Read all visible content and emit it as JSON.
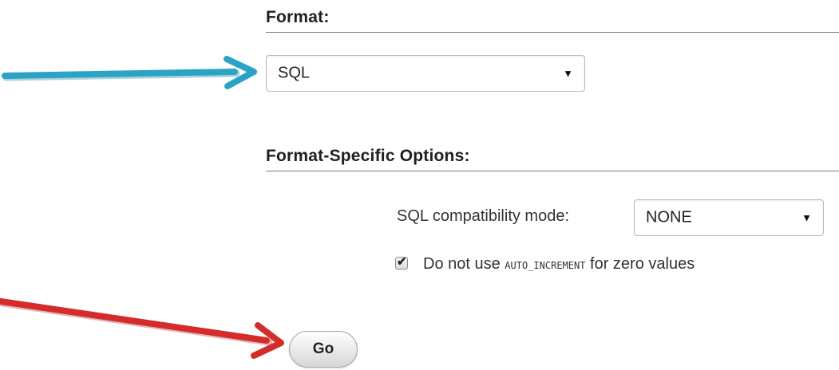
{
  "format_section": {
    "heading": "Format:",
    "select": {
      "value": "SQL",
      "caret_icon": "triangle-down"
    }
  },
  "options_section": {
    "heading": "Format-Specific Options:",
    "compatibility": {
      "label": "SQL compatibility mode:",
      "value": "NONE",
      "caret_icon": "triangle-down"
    },
    "auto_increment": {
      "checked": true,
      "text_before": "Do not use",
      "code": "AUTO_INCREMENT",
      "text_after": "for zero values"
    }
  },
  "actions": {
    "go_label": "Go"
  },
  "annotations": {
    "format_arrow_color": "#2aa3c6",
    "go_arrow_color": "#d52b2b"
  }
}
